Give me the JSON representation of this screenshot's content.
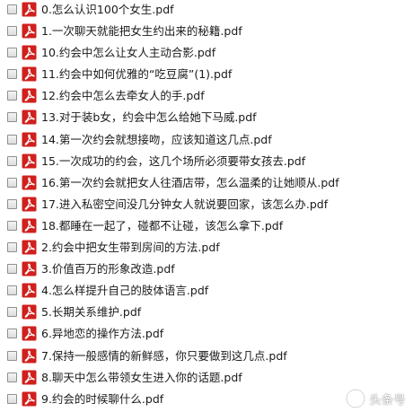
{
  "files": [
    {
      "name": "0.怎么认识100个女生.pdf",
      "icon": "pdf-icon"
    },
    {
      "name": "1.一次聊天就能把女生约出来的秘籍.pdf",
      "icon": "pdf-icon"
    },
    {
      "name": "10.约会中怎么让女人主动合影.pdf",
      "icon": "pdf-icon"
    },
    {
      "name": "11.约会中如何优雅的“吃豆腐”(1).pdf",
      "icon": "pdf-icon"
    },
    {
      "name": "12.约会中怎么去牵女人的手.pdf",
      "icon": "pdf-icon"
    },
    {
      "name": "13.对于装b女，约会中怎么给她下马威.pdf",
      "icon": "pdf-icon"
    },
    {
      "name": "14.第一次约会就想接吻，应该知道这几点.pdf",
      "icon": "pdf-icon"
    },
    {
      "name": "15.一次成功的约会，这几个场所必须要带女孩去.pdf",
      "icon": "pdf-icon"
    },
    {
      "name": "16.第一次约会就把女人往酒店带，怎么温柔的让她顺从.pdf",
      "icon": "pdf-icon"
    },
    {
      "name": "17.进入私密空间没几分钟女人就说要回家，该怎么办.pdf",
      "icon": "pdf-icon"
    },
    {
      "name": "18.都睡在一起了，碰都不让碰，该怎么拿下.pdf",
      "icon": "pdf-icon"
    },
    {
      "name": "2.约会中把女生带到房间的方法.pdf",
      "icon": "pdf-icon"
    },
    {
      "name": "3.价值百万的形象改造.pdf",
      "icon": "pdf-icon"
    },
    {
      "name": "4.怎么样提升自己的肢体语言.pdf",
      "icon": "pdf-icon"
    },
    {
      "name": "5.长期关系维护.pdf",
      "icon": "pdf-icon"
    },
    {
      "name": "6.异地恋的操作方法.pdf",
      "icon": "pdf-icon"
    },
    {
      "name": "7.保持一般感情的新鲜感，你只要做到这几点.pdf",
      "icon": "pdf-icon"
    },
    {
      "name": "8.聊天中怎么带领女生进入你的话题.pdf",
      "icon": "pdf-icon"
    },
    {
      "name": "9.约会的时候聊什么.pdf",
      "icon": "pdf-icon"
    }
  ],
  "watermark": {
    "text": "头条号"
  },
  "colors": {
    "pdf_red": "#d0201d",
    "text": "#1a1a1a",
    "checkbox_border": "#8e8f8f"
  }
}
